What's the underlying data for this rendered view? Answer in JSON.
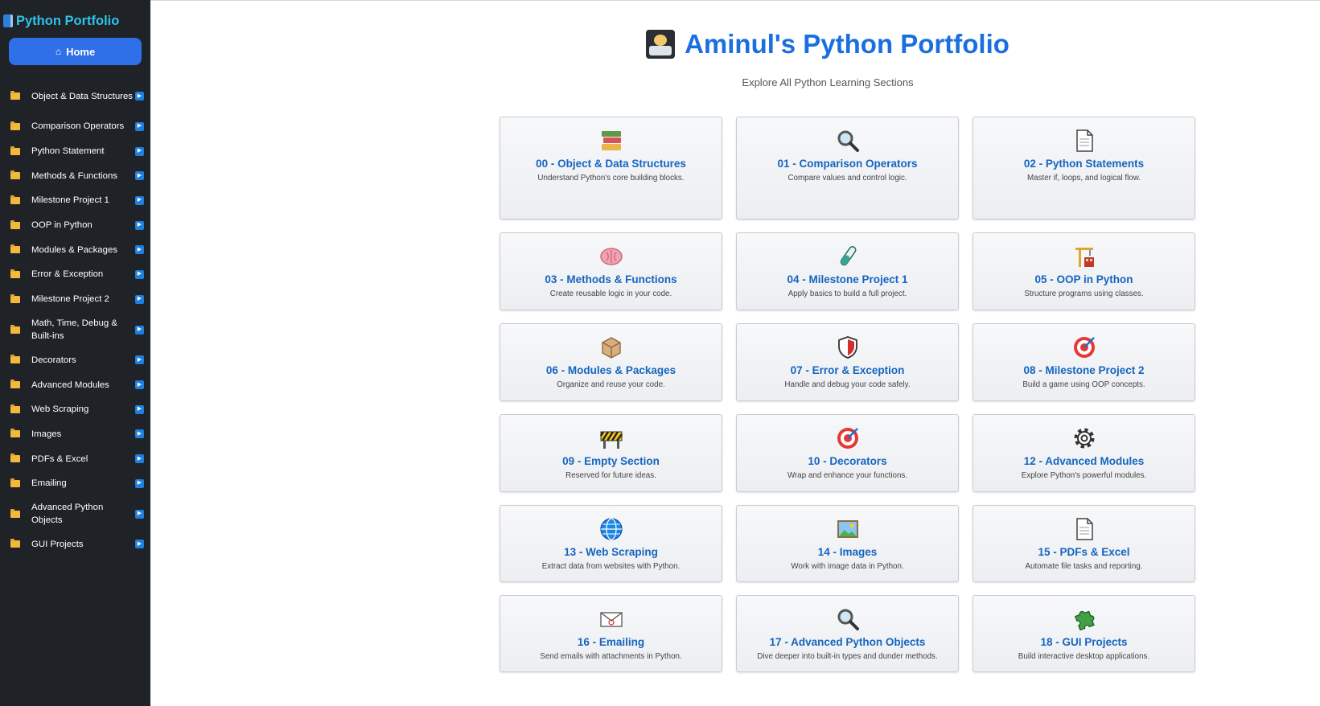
{
  "sidebar": {
    "brand": "Python Portfolio",
    "home_label": "Home",
    "items": [
      {
        "label": "Object & Data Structures"
      },
      {
        "label": "Comparison Operators"
      },
      {
        "label": "Python Statement"
      },
      {
        "label": "Methods & Functions"
      },
      {
        "label": "Milestone Project 1"
      },
      {
        "label": "OOP in Python"
      },
      {
        "label": "Modules & Packages"
      },
      {
        "label": "Error & Exception"
      },
      {
        "label": "Milestone Project 2"
      },
      {
        "label": "Math, Time, Debug & Built-ins"
      },
      {
        "label": "Decorators"
      },
      {
        "label": "Advanced Modules"
      },
      {
        "label": "Web Scraping"
      },
      {
        "label": "Images"
      },
      {
        "label": "PDFs & Excel"
      },
      {
        "label": "Emailing"
      },
      {
        "label": "Advanced Python Objects"
      },
      {
        "label": "GUI Projects"
      }
    ]
  },
  "main": {
    "title": "Aminul's Python Portfolio",
    "subtitle": "Explore All Python Learning Sections",
    "cards": [
      {
        "title": "00 - Object & Data Structures",
        "desc": "Understand Python's core building blocks.",
        "icon": "books-icon"
      },
      {
        "title": "01 - Comparison Operators",
        "desc": "Compare values and control logic.",
        "icon": "magnifier-icon"
      },
      {
        "title": "02 - Python Statements",
        "desc": "Master if, loops, and logical flow.",
        "icon": "page-icon"
      },
      {
        "title": "03 - Methods & Functions",
        "desc": "Create reusable logic in your code.",
        "icon": "brain-icon"
      },
      {
        "title": "04 - Milestone Project 1",
        "desc": "Apply basics to build a full project.",
        "icon": "test-tube-icon"
      },
      {
        "title": "05 - OOP in Python",
        "desc": "Structure programs using classes.",
        "icon": "crane-icon"
      },
      {
        "title": "06 - Modules & Packages",
        "desc": "Organize and reuse your code.",
        "icon": "package-icon"
      },
      {
        "title": "07 - Error & Exception",
        "desc": "Handle and debug your code safely.",
        "icon": "shield-icon"
      },
      {
        "title": "08 - Milestone Project 2",
        "desc": "Build a game using OOP concepts.",
        "icon": "target-icon"
      },
      {
        "title": "09 - Empty Section",
        "desc": "Reserved for future ideas.",
        "icon": "construction-icon"
      },
      {
        "title": "10 - Decorators",
        "desc": "Wrap and enhance your functions.",
        "icon": "target-icon"
      },
      {
        "title": "12 - Advanced Modules",
        "desc": "Explore Python's powerful modules.",
        "icon": "gear-icon"
      },
      {
        "title": "13 - Web Scraping",
        "desc": "Extract data from websites with Python.",
        "icon": "globe-icon"
      },
      {
        "title": "14 - Images",
        "desc": "Work with image data in Python.",
        "icon": "picture-icon"
      },
      {
        "title": "15 - PDFs & Excel",
        "desc": "Automate file tasks and reporting.",
        "icon": "page-icon"
      },
      {
        "title": "16 - Emailing",
        "desc": "Send emails with attachments in Python.",
        "icon": "envelope-icon"
      },
      {
        "title": "17 - Advanced Python Objects",
        "desc": "Dive deeper into built-in types and dunder methods.",
        "icon": "magnifier-icon"
      },
      {
        "title": "18 - GUI Projects",
        "desc": "Build interactive desktop applications.",
        "icon": "puzzle-icon"
      }
    ]
  }
}
